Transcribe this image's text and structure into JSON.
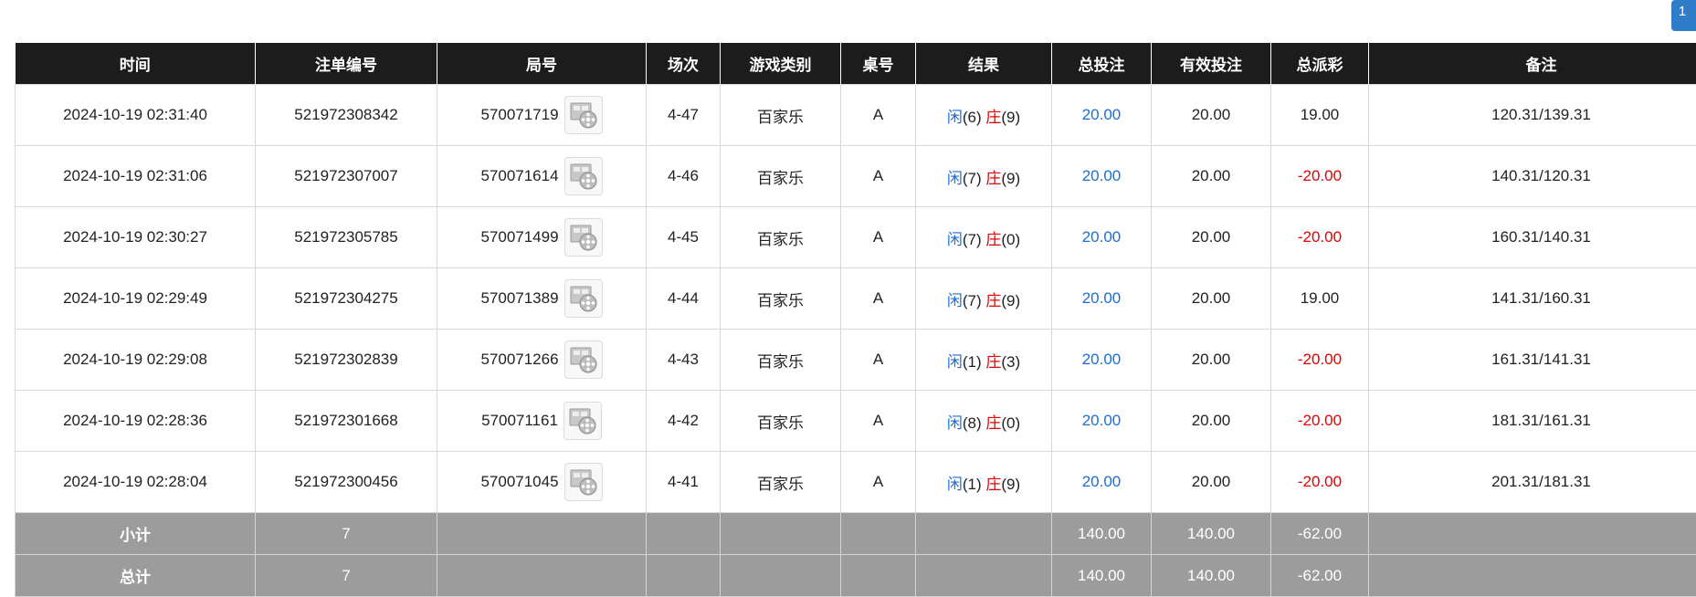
{
  "pagination": {
    "current": "1"
  },
  "columns": [
    "时间",
    "注单编号",
    "局号",
    "场次",
    "游戏类别",
    "桌号",
    "结果",
    "总投注",
    "有效投注",
    "总派彩",
    "备注"
  ],
  "rows": [
    {
      "time": "2024-10-19 02:31:40",
      "order": "521972308342",
      "round": "570071719",
      "session": "4-47",
      "game": "百家乐",
      "table": "A",
      "player_label": "闲",
      "player_score": "(6)",
      "banker_label": "庄",
      "banker_score": "(9)",
      "bet": "20.00",
      "valid": "20.00",
      "payout": "19.00",
      "payout_negative": false,
      "note": "120.31/139.31"
    },
    {
      "time": "2024-10-19 02:31:06",
      "order": "521972307007",
      "round": "570071614",
      "session": "4-46",
      "game": "百家乐",
      "table": "A",
      "player_label": "闲",
      "player_score": "(7)",
      "banker_label": "庄",
      "banker_score": "(9)",
      "bet": "20.00",
      "valid": "20.00",
      "payout": "-20.00",
      "payout_negative": true,
      "note": "140.31/120.31"
    },
    {
      "time": "2024-10-19 02:30:27",
      "order": "521972305785",
      "round": "570071499",
      "session": "4-45",
      "game": "百家乐",
      "table": "A",
      "player_label": "闲",
      "player_score": "(7)",
      "banker_label": "庄",
      "banker_score": "(0)",
      "bet": "20.00",
      "valid": "20.00",
      "payout": "-20.00",
      "payout_negative": true,
      "note": "160.31/140.31"
    },
    {
      "time": "2024-10-19 02:29:49",
      "order": "521972304275",
      "round": "570071389",
      "session": "4-44",
      "game": "百家乐",
      "table": "A",
      "player_label": "闲",
      "player_score": "(7)",
      "banker_label": "庄",
      "banker_score": "(9)",
      "bet": "20.00",
      "valid": "20.00",
      "payout": "19.00",
      "payout_negative": false,
      "note": "141.31/160.31"
    },
    {
      "time": "2024-10-19 02:29:08",
      "order": "521972302839",
      "round": "570071266",
      "session": "4-43",
      "game": "百家乐",
      "table": "A",
      "player_label": "闲",
      "player_score": "(1)",
      "banker_label": "庄",
      "banker_score": "(3)",
      "bet": "20.00",
      "valid": "20.00",
      "payout": "-20.00",
      "payout_negative": true,
      "note": "161.31/141.31"
    },
    {
      "time": "2024-10-19 02:28:36",
      "order": "521972301668",
      "round": "570071161",
      "session": "4-42",
      "game": "百家乐",
      "table": "A",
      "player_label": "闲",
      "player_score": "(8)",
      "banker_label": "庄",
      "banker_score": "(0)",
      "bet": "20.00",
      "valid": "20.00",
      "payout": "-20.00",
      "payout_negative": true,
      "note": "181.31/161.31"
    },
    {
      "time": "2024-10-19 02:28:04",
      "order": "521972300456",
      "round": "570071045",
      "session": "4-41",
      "game": "百家乐",
      "table": "A",
      "player_label": "闲",
      "player_score": "(1)",
      "banker_label": "庄",
      "banker_score": "(9)",
      "bet": "20.00",
      "valid": "20.00",
      "payout": "-20.00",
      "payout_negative": true,
      "note": "201.31/181.31"
    }
  ],
  "subtotal": {
    "label": "小计",
    "count": "7",
    "bet": "140.00",
    "valid": "140.00",
    "payout": "-62.00"
  },
  "total": {
    "label": "总计",
    "count": "7",
    "bet": "140.00",
    "valid": "140.00",
    "payout": "-62.00"
  },
  "colors": {
    "header_bg": "#1c1c1c",
    "summary_bg": "#9c9c9c",
    "accent_blue": "#1a6fd6",
    "negative_red": "#e60000",
    "page_button": "#2f7dc9"
  },
  "icons": {
    "replay": "film-reel-icon"
  }
}
